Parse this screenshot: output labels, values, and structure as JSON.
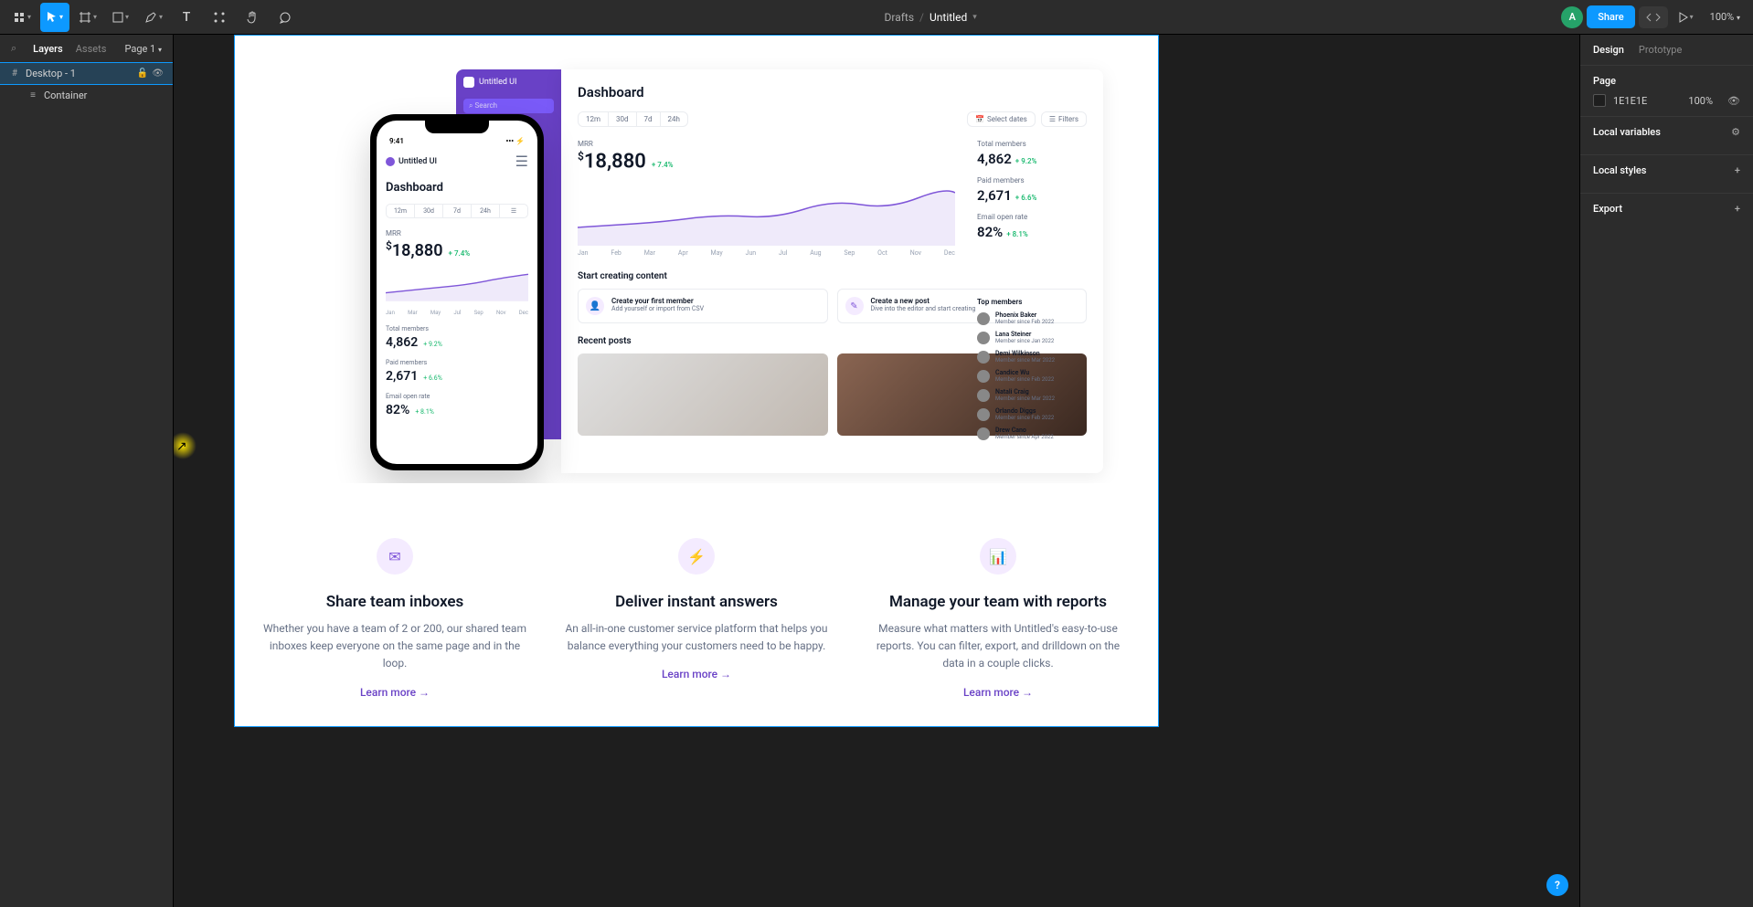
{
  "toolbar": {
    "breadcrumb_parent": "Drafts",
    "breadcrumb_current": "Untitled",
    "avatar_initial": "A",
    "share_label": "Share",
    "zoom_label": "100%"
  },
  "left_panel": {
    "tab_layers": "Layers",
    "tab_assets": "Assets",
    "page_label": "Page 1",
    "layers": [
      {
        "name": "Desktop - 1",
        "selected": true
      },
      {
        "name": "Container",
        "selected": false
      }
    ]
  },
  "right_panel": {
    "tab_design": "Design",
    "tab_prototype": "Prototype",
    "page_section": "Page",
    "bg_hex": "1E1E1E",
    "bg_opacity": "100%",
    "local_vars": "Local variables",
    "local_styles": "Local styles",
    "export": "Export"
  },
  "design": {
    "app_name": "Untitled UI",
    "search_placeholder": "Search",
    "dashboard_title": "Dashboard",
    "segments": [
      "12m",
      "30d",
      "7d",
      "24h"
    ],
    "select_dates": "Select dates",
    "filters": "Filters",
    "mrr_label": "MRR",
    "mrr_value": "18,880",
    "mrr_delta": "+ 7.4%",
    "months": [
      "Jan",
      "Feb",
      "Mar",
      "Apr",
      "May",
      "Jun",
      "Jul",
      "Aug",
      "Sep",
      "Oct",
      "Nov",
      "Dec"
    ],
    "stats": {
      "total_label": "Total members",
      "total_val": "4,862",
      "total_delta": "+ 9.2%",
      "paid_label": "Paid members",
      "paid_val": "2,671",
      "paid_delta": "+ 6.6%",
      "open_label": "Email open rate",
      "open_val": "82%",
      "open_delta": "+ 8.1%"
    },
    "start_creating": "Start creating content",
    "card1_title": "Create your first member",
    "card1_sub": "Add yourself or import from CSV",
    "card2_title": "Create a new post",
    "card2_sub": "Dive into the editor and start creating",
    "recent_posts": "Recent posts",
    "top_members_hdr": "Top members",
    "members": [
      {
        "name": "Phoenix Baker",
        "since": "Member since Feb 2022"
      },
      {
        "name": "Lana Steiner",
        "since": "Member since Jan 2022"
      },
      {
        "name": "Demi Wilkinson",
        "since": "Member since Mar 2022"
      },
      {
        "name": "Candice Wu",
        "since": "Member since Feb 2022"
      },
      {
        "name": "Natali Craig",
        "since": "Member since Mar 2022"
      },
      {
        "name": "Orlando Diggs",
        "since": "Member since Feb 2022"
      },
      {
        "name": "Drew Cano",
        "since": "Member since Apr 2022"
      }
    ],
    "phone": {
      "time": "9:41",
      "title": "Dashboard",
      "total_val": "4,862",
      "total_delta": "+ 9.2%",
      "paid_val": "2,671",
      "paid_delta": "+ 6.6%",
      "open_val": "82%",
      "open_delta": "+ 8.1%"
    },
    "features": [
      {
        "title": "Share team inboxes",
        "desc": "Whether you have a team of 2 or 200, our shared team inboxes keep everyone on the same page and in the loop.",
        "link": "Learn more"
      },
      {
        "title": "Deliver instant answers",
        "desc": "An all-in-one customer service platform that helps you balance everything your customers need to be happy.",
        "link": "Learn more"
      },
      {
        "title": "Manage your team with reports",
        "desc": "Measure what matters with Untitled's easy-to-use reports. You can filter, export, and drilldown on the data in a couple clicks.",
        "link": "Learn more"
      }
    ]
  },
  "chart_data": {
    "type": "line",
    "title": "MRR",
    "x": [
      "Jan",
      "Feb",
      "Mar",
      "Apr",
      "May",
      "Jun",
      "Jul",
      "Aug",
      "Sep",
      "Oct",
      "Nov",
      "Dec"
    ],
    "values": [
      14000,
      14200,
      14100,
      14800,
      15200,
      15000,
      15800,
      16400,
      16200,
      17200,
      17800,
      18880
    ],
    "ylabel": "MRR ($)"
  }
}
